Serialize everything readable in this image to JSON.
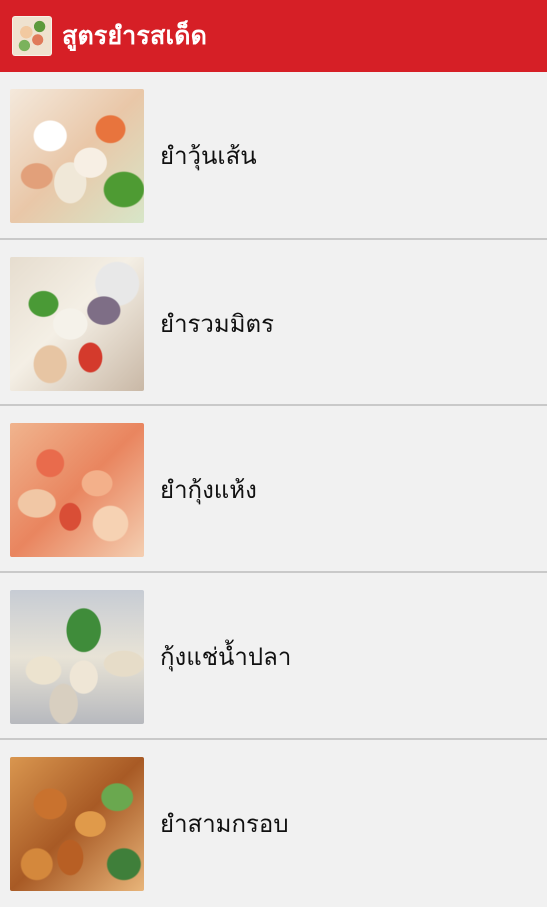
{
  "app_bar": {
    "title": "สูตรยำรสเด็ด",
    "icon": "app-logo-icon",
    "color": "#d61f26"
  },
  "list": {
    "items": [
      {
        "label": "ยำวุ้นเส้น",
        "thumbnail": "glass-noodle-salad-photo"
      },
      {
        "label": "ยำรวมมิตร",
        "thumbnail": "mixed-salad-photo"
      },
      {
        "label": "ยำกุ้งแห้ง",
        "thumbnail": "dried-shrimp-salad-photo"
      },
      {
        "label": "กุ้งแช่น้ำปลา",
        "thumbnail": "raw-shrimp-fish-sauce-photo"
      },
      {
        "label": "ยำสามกรอบ",
        "thumbnail": "three-crispy-salad-photo"
      }
    ]
  }
}
